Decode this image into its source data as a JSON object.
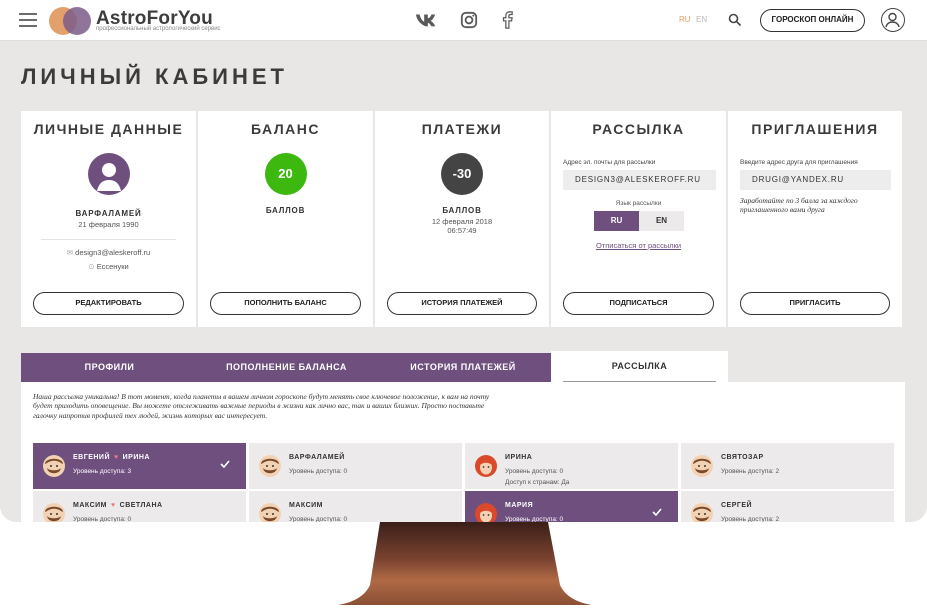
{
  "header": {
    "logo_title": "AstroForYou",
    "logo_subtitle": "профессиональный астрологический сервис",
    "social": [
      "vk-icon",
      "instagram-icon",
      "facebook-icon"
    ],
    "lang_active": "RU",
    "lang_other": "EN",
    "horoscope_button": "ГОРОСКОП ОНЛАЙН"
  },
  "page_title": "ЛИЧНЫЙ КАБИНЕТ",
  "cards": {
    "personal": {
      "title": "ЛИЧНЫЕ ДАННЫЕ",
      "name": "ВАРФАЛАМЕЙ",
      "birthdate": "21 февраля 1990",
      "email": "design3@aleskeroff.ru",
      "city": "Ессенуки",
      "button": "РЕДАКТИРОВАТЬ"
    },
    "balance": {
      "title": "БАЛАНС",
      "value": "20",
      "unit": "БАЛЛОВ",
      "button": "ПОПОЛНИТЬ БАЛАНС",
      "color": "#3cb80f"
    },
    "payments": {
      "title": "ПЛАТЕЖИ",
      "value": "-30",
      "unit": "БАЛЛОВ",
      "date": "12 февраля 2018",
      "time": "06:57:49",
      "button": "ИСТОРИЯ ПЛАТЕЖЕЙ",
      "color": "#444444"
    },
    "mailing": {
      "title": "РАССЫЛКА",
      "email_label": "Адрес эл. почты для рассылки",
      "email_value": "DESIGN3@ALESKEROFF.RU",
      "lang_label": "Язык рассылки",
      "lang_ru": "RU",
      "lang_en": "EN",
      "unsubscribe": "Отписаться от рассылки",
      "button": "ПОДПИСАТЬСЯ"
    },
    "invites": {
      "title": "ПРИГЛАШЕНИЯ",
      "email_label": "Введите адрес друга для приглашения",
      "email_value": "DRUGI@YANDEX.RU",
      "note": "Заработайте по 3 балла за каждого приглашенного вами друга",
      "button": "ПРИГЛАСИТЬ"
    }
  },
  "tabs": [
    "ПРОФИЛИ",
    "ПОПОЛНЕНИЕ БАЛАНСА",
    "ИСТОРИЯ ПЛАТЕЖЕЙ",
    "РАССЫЛКА"
  ],
  "active_tab": "РАССЫЛКА",
  "intro_text": "Наша рассылка уникальна! В тот момент, когда планеты в вашем личном гороскопе будут менять свое ключевое положение, к вам на почту будет приходить оповещение. Вы можете отслеживать важные периоды в жизни как лично вас, так и ваших близких. Просто поставьте галочку напротив профилей тех людей, жизнь которых вас интересует.",
  "profiles": [
    {
      "name": "ЕВГЕНИЙ",
      "partner": "ИРИНА",
      "level": "Уровень доступа: 3",
      "selected": true,
      "face": "male"
    },
    {
      "name": "ВАРФАЛАМЕЙ",
      "level": "Уровень доступа: 0",
      "selected": false,
      "face": "male"
    },
    {
      "name": "ИРИНА",
      "level": "Уровень доступа: 0",
      "extra": "Доступ к странам: Да",
      "selected": false,
      "face": "female"
    },
    {
      "name": "СВЯТОЗАР",
      "level": "Уровень доступа: 2",
      "selected": false,
      "face": "male"
    },
    {
      "name": "МАКСИМ",
      "partner": "СВЕТЛАНА",
      "level": "Уровень доступа: 0",
      "selected": false,
      "face": "male"
    },
    {
      "name": "МАКСИМ",
      "level": "Уровень доступа: 0",
      "selected": false,
      "face": "male"
    },
    {
      "name": "МАРИЯ",
      "level": "Уровень доступа: 0",
      "selected": true,
      "face": "female"
    },
    {
      "name": "СЕРГЕЙ",
      "level": "Уровень доступа: 2",
      "selected": false,
      "face": "male"
    }
  ],
  "colors": {
    "accent": "#6e4f7e",
    "balance_positive": "#3cb80f",
    "logo_orange": "#e2a06a",
    "heart": "#e97c7c",
    "stand_brown": "#8a4f35"
  }
}
